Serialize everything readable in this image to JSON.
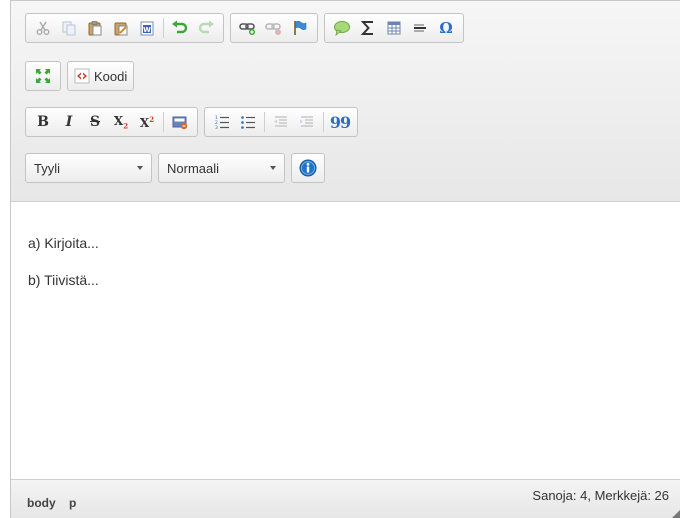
{
  "toolbar": {
    "row1": {
      "clipboard": [
        "cut-icon",
        "copy-icon",
        "paste-icon",
        "paste-text-icon",
        "paste-word-icon"
      ],
      "history": [
        "undo-icon",
        "redo-icon"
      ],
      "links": [
        "link-icon",
        "unlink-icon",
        "anchor-icon"
      ],
      "insert": [
        "comment-icon",
        "sigma-icon",
        "table-icon",
        "horizontal-rule-icon",
        "omega-icon"
      ]
    },
    "row2": {
      "maximize": "maximize-icon",
      "source_label": "Koodi"
    },
    "row3": {
      "bold": "B",
      "italic": "I",
      "strike": "S",
      "subscript": "X",
      "subscript_mark": "2",
      "superscript": "X",
      "superscript_mark": "2",
      "quote": "99"
    },
    "row4": {
      "style_label": "Tyyli",
      "format_label": "Normaali"
    }
  },
  "content": {
    "paragraphs": [
      "a) Kirjoita...",
      "b) Tiivistä..."
    ]
  },
  "statusbar": {
    "path": [
      "body",
      "p"
    ],
    "wordcount": "Sanoja: 4, Merkkejä: 26"
  },
  "colors": {
    "accent_green": "#3aa835",
    "accent_blue": "#2b6fc4",
    "accent_red": "#d33b2c",
    "info_blue": "#1e73c9"
  }
}
